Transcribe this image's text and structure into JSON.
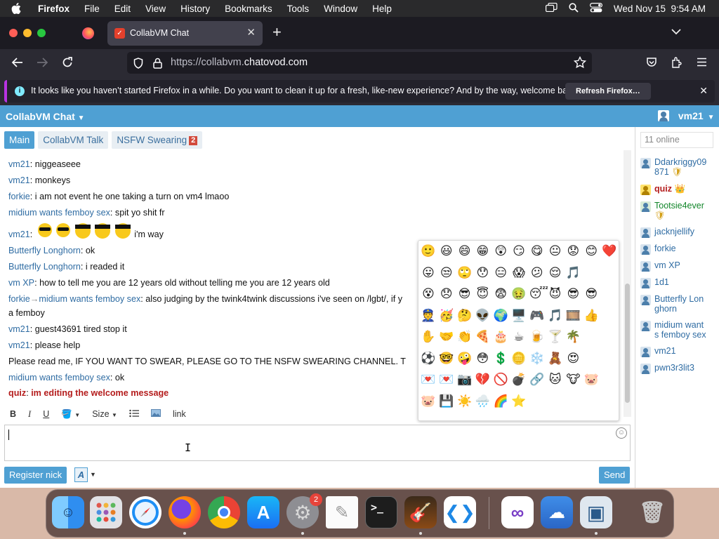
{
  "menubar": {
    "app": "Firefox",
    "items": [
      "File",
      "Edit",
      "View",
      "History",
      "Bookmarks",
      "Tools",
      "Window",
      "Help"
    ],
    "datetime": "Wed Nov 15  9:54 AM"
  },
  "browser": {
    "tab_title": "CollabVM Chat",
    "url_prefix": "https://collabvm.",
    "url_domain": "chatovod.com",
    "notice_text": "It looks like you haven’t started Firefox in a while. Do you want to clean it up for a fresh, like-new experience? And by the way, welcome back!",
    "refresh_label": "Refresh Firefox…"
  },
  "app": {
    "title": "CollabVM Chat",
    "user": "vm21",
    "tabs": [
      {
        "label": "Main",
        "active": true
      },
      {
        "label": "CollabVM Talk"
      },
      {
        "label": "NSFW Swearing",
        "badge": "2"
      }
    ],
    "online": "11 online",
    "toolbar": {
      "bold": "B",
      "italic": "I",
      "underline": "U",
      "size": "Size",
      "link": "link"
    },
    "register_label": "Register nick",
    "send_label": "Send",
    "font_btn": "A"
  },
  "messages": [
    {
      "nick": "vm21",
      "text": "niggeaseee"
    },
    {
      "nick": "vm21",
      "text": "monkeys"
    },
    {
      "nick": "forkie",
      "text": "i am not event he one taking a turn on vm4 lmaoo"
    },
    {
      "nick": "midium wants femboy sex",
      "text": "spit yo shit fr"
    },
    {
      "nick": "vm21",
      "text": "i'm way"
    },
    {
      "nick": "Butterfly Longhorn",
      "text": "ok"
    },
    {
      "nick": "Butterfly Longhorn",
      "text": "i readed it"
    },
    {
      "nick": "vm XP",
      "text": "how to tell me you are 12 years old without telling me you are 12 years old"
    },
    {
      "nick": "forkie",
      "to": "midium wants femboy sex",
      "arrow": "→",
      "text": "also judging by the twink4twink discussions i've seen on /lgbt/, if y",
      "cont": "a femboy"
    },
    {
      "nick": "vm21",
      "text": "guest43691 tired stop it"
    },
    {
      "nick": "vm21",
      "text": "please help"
    },
    {
      "nick": "",
      "text": "Please read me, IF YOU WANT TO SWEAR, PLEASE GO TO THE NSFW SWEARING CHANNEL. T"
    },
    {
      "nick": "midium wants femboy sex",
      "text": "ok"
    },
    {
      "nick": "quiz",
      "text": "im editing the welcome message"
    }
  ],
  "users": [
    "Ddarkriggy09871",
    "quiz",
    "Tootsie4ever",
    "jacknjellify",
    "forkie",
    "vm XP",
    "1d1",
    "Butterfly Longhorn",
    "midium wants femboy sex",
    "vm21",
    "pwn3r3lit3"
  ],
  "user_lines": [
    [
      "Ddarkriggy09",
      "871"
    ],
    [
      "quiz"
    ],
    [
      "Tootsie4ever"
    ],
    [
      "jacknjellify"
    ],
    [
      "forkie"
    ],
    [
      "vm XP"
    ],
    [
      "1d1"
    ],
    [
      "Butterfly Lon",
      "ghorn"
    ],
    [
      "midium want",
      "s femboy sex"
    ],
    [
      "vm21"
    ],
    [
      "pwn3r3lit3"
    ]
  ],
  "emoji_rows": [
    [
      "🙂",
      "😃",
      "😄",
      "😁",
      "😲",
      "😏",
      "😋",
      "😐",
      "😟",
      "😊",
      "❤️"
    ],
    [
      "😛",
      "😒",
      "🙄",
      "😯",
      "😑",
      "😱",
      "😕",
      "😌",
      "🎵"
    ],
    [
      "😵",
      "😞",
      "😎",
      "😇",
      "😨",
      "🤢",
      "😴",
      "😈",
      "😎",
      "😎"
    ],
    [
      "👮",
      "🥳",
      "🤔",
      "👽",
      "🌍",
      "🖥️",
      "🎮",
      "🎵",
      "🎞️",
      "👍"
    ],
    [
      "✋",
      "🤝",
      "👏",
      "🍕",
      "🎂",
      "☕",
      "🍺",
      "🍸",
      "🌴"
    ],
    [
      "⚽",
      "🤓",
      "🤪",
      "😳",
      "💲",
      "🪙",
      "❄️",
      "🧸",
      "😍"
    ],
    [
      "💌",
      "💌",
      "📷",
      "💔",
      "🚫",
      "💣",
      "🔗",
      "🐱",
      "🐮",
      "🐷"
    ],
    [
      "🐷",
      "💾",
      "☀️",
      "🌧️",
      "🌈",
      "⭐"
    ]
  ],
  "dock_badge": "2"
}
